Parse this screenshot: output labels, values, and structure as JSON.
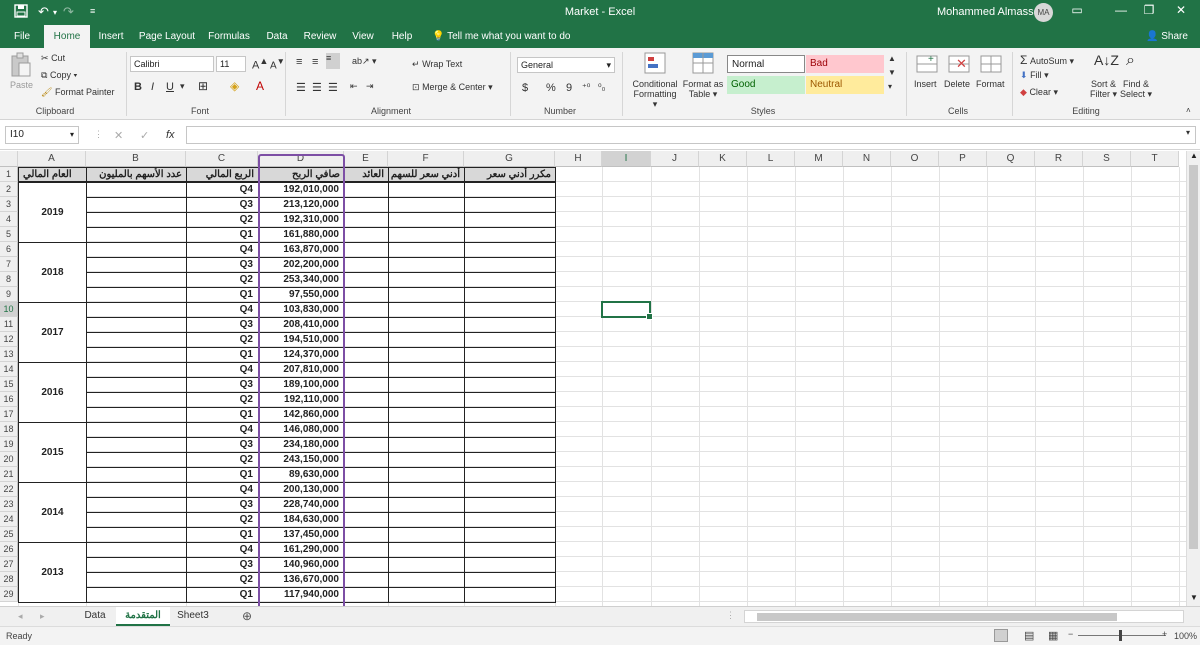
{
  "window": {
    "title": "Market  -  Excel",
    "user": "Mohammed Almasseri",
    "avatar": "MA",
    "qa_icons": [
      "save-icon",
      "undo-icon",
      "redo-icon",
      "customize-icon"
    ],
    "controls": [
      "ribbon-display-icon",
      "minimize-icon",
      "restore-icon",
      "close-icon"
    ]
  },
  "menu": {
    "tabs": [
      "File",
      "Home",
      "Insert",
      "Page Layout",
      "Formulas",
      "Data",
      "Review",
      "View",
      "Help"
    ],
    "active": "Home",
    "tell_me": "Tell me what you want to do",
    "share": "Share"
  },
  "ribbon": {
    "clipboard": {
      "paste": "Paste",
      "cut": "Cut",
      "copy": "Copy",
      "format_painter": "Format Painter",
      "label": "Clipboard"
    },
    "font": {
      "family": "Calibri",
      "size": "11",
      "label": "Font",
      "bold": "B",
      "italic": "I",
      "underline": "U"
    },
    "alignment": {
      "wrap": "Wrap Text",
      "merge": "Merge & Center",
      "label": "Alignment"
    },
    "number": {
      "format": "General",
      "currency": "$",
      "percent": "%",
      "comma": "9",
      "label": "Number"
    },
    "styles": {
      "conditional": "Conditional",
      "conditional2": "Formatting",
      "format_as": "Format as",
      "format_as2": "Table",
      "normal": "Normal",
      "bad": "Bad",
      "good": "Good",
      "neutral": "Neutral",
      "label": "Styles",
      "colors": {
        "normal_bg": "#ffffff",
        "bad_bg": "#ffc7ce",
        "bad_fg": "#9c0006",
        "good_bg": "#c6efce",
        "good_fg": "#006100",
        "neutral_bg": "#ffeb9c",
        "neutral_fg": "#9c5700"
      }
    },
    "cells": {
      "insert": "Insert",
      "delete": "Delete",
      "format": "Format",
      "label": "Cells"
    },
    "editing": {
      "autosum": "AutoSum",
      "fill": "Fill",
      "clear": "Clear",
      "sort": "Sort &",
      "sort2": "Filter",
      "find": "Find &",
      "find2": "Select",
      "label": "Editing"
    }
  },
  "formula_bar": {
    "name_box": "I10",
    "fx": "fx",
    "formula": ""
  },
  "grid": {
    "columns": [
      "A",
      "B",
      "C",
      "D",
      "E",
      "F",
      "G",
      "H",
      "I",
      "J",
      "K",
      "L",
      "M",
      "N",
      "O",
      "P",
      "Q",
      "R",
      "S",
      "T"
    ],
    "selected_column": "I",
    "selected_row": 10,
    "headers": {
      "A": "العام المالي",
      "B": "عدد الأسهم بالمليون",
      "C": "الربع المالي",
      "D": "صافي الربح",
      "E": "العائد",
      "F": "أدني سعر للسهم",
      "G": "مكرر أدني سعر"
    },
    "years": [
      "2019",
      "2018",
      "2017",
      "2016",
      "2015",
      "2014",
      "2013"
    ],
    "quarters": [
      "Q4",
      "Q3",
      "Q2",
      "Q1"
    ],
    "net_profit": [
      "192,010,000",
      "213,120,000",
      "192,310,000",
      "161,880,000",
      "163,870,000",
      "202,200,000",
      "253,340,000",
      "97,550,000",
      "103,830,000",
      "208,410,000",
      "194,510,000",
      "124,370,000",
      "207,810,000",
      "189,100,000",
      "192,110,000",
      "142,860,000",
      "146,080,000",
      "234,180,000",
      "243,150,000",
      "89,630,000",
      "200,130,000",
      "228,740,000",
      "184,630,000",
      "137,450,000",
      "161,290,000",
      "140,960,000",
      "136,670,000",
      "117,940,000"
    ]
  },
  "sheets": {
    "tabs": [
      "Data",
      "المتقدمة",
      "Sheet3"
    ],
    "active": "المتقدمة"
  },
  "status": {
    "ready": "Ready",
    "zoom": "100%"
  }
}
